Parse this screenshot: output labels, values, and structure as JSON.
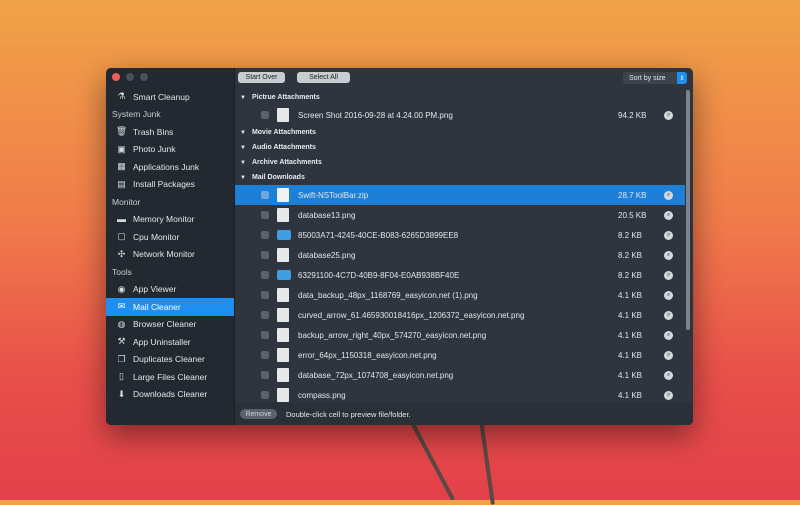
{
  "toolbar": {
    "start_over": "Start Over",
    "select_all": "Select All",
    "sort": "Sort by size"
  },
  "sidebar": {
    "smart_cleanup": "Smart Cleanup",
    "system_junk": "System Junk",
    "trash_bins": "Trash Bins",
    "photo_junk": "Photo Junk",
    "applications_junk": "Applications Junk",
    "install_packages": "Install Packages",
    "monitor": "Monitor",
    "memory_monitor": "Memory Monitor",
    "cpu_monitor": "Cpu Monitor",
    "network_monitor": "Network Monitor",
    "tools": "Tools",
    "app_viewer": "App Viewer",
    "mail_cleaner": "Mail Cleaner",
    "browser_cleaner": "Browser Cleaner",
    "app_uninstaller": "App Uninstaller",
    "duplicates_cleaner": "Duplicates Cleaner",
    "large_files_cleaner": "Large Files Cleaner",
    "downloads_cleaner": "Downloads Cleaner"
  },
  "groups": {
    "picture": "Pictrue Attachments",
    "movie": "Movie Attachments",
    "audio": "Audio Attachments",
    "archive": "Archive Attachments",
    "mail_downloads": "Mail Downloads"
  },
  "picture_files": [
    {
      "name": "Screen Shot 2016-09-28 at 4.24.00 PM.png",
      "size": "94.2 KB"
    }
  ],
  "download_files": [
    {
      "name": "Swift-NSToolBar.zip",
      "size": "28.7 KB"
    },
    {
      "name": "database13.png",
      "size": "20.5 KB"
    },
    {
      "name": "85003A71-4245-40CE-B083-6265D3899EE8",
      "size": "8.2 KB"
    },
    {
      "name": "database25.png",
      "size": "8.2 KB"
    },
    {
      "name": "63291100-4C7D-40B9-8F04-E0AB938BF40E",
      "size": "8.2 KB"
    },
    {
      "name": "data_backup_48px_1168769_easyicon.net (1).png",
      "size": "4.1 KB"
    },
    {
      "name": "curved_arrow_61.465930018416px_1206372_easyicon.net.png",
      "size": "4.1 KB"
    },
    {
      "name": "backup_arrow_right_40px_574270_easyicon.net.png",
      "size": "4.1 KB"
    },
    {
      "name": "error_64px_1150318_easyicon.net.png",
      "size": "4.1 KB"
    },
    {
      "name": "database_72px_1074708_easyicon.net.png",
      "size": "4.1 KB"
    },
    {
      "name": "compass.png",
      "size": "4.1 KB"
    }
  ],
  "footer": {
    "remove": "Remove",
    "hint": "Double-click cell to preview file/folder."
  }
}
